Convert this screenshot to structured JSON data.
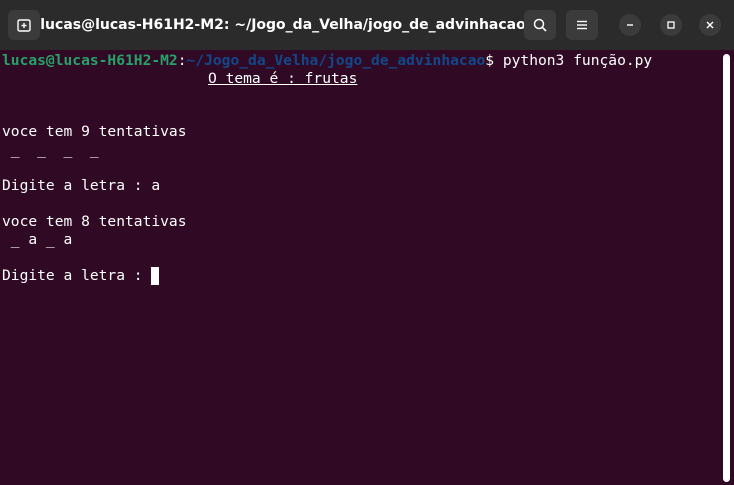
{
  "window": {
    "title": "lucas@lucas-H61H2-M2: ~/Jogo_da_Velha/jogo_de_advinhacao"
  },
  "titlebar": {
    "icons": [
      "new-tab-icon",
      "search-icon",
      "hamburger-menu-icon",
      "minimize-icon",
      "maximize-icon",
      "close-icon"
    ]
  },
  "terminal": {
    "prompt_user": "lucas@lucas-H61H2-M2",
    "prompt_sep": ":",
    "prompt_path": "~/Jogo_da_Velha/jogo_de_advinhacao",
    "prompt_symbol": "$ ",
    "command": "python3 função.py",
    "theme_line": "O tema é : frutas",
    "attempts_1": "voce tem 9 tentativas",
    "board_1": " _  _  _  _",
    "prompt_letter_1": "Digite a letra : a",
    "attempts_2": "voce tem 8 tentativas",
    "board_2": " _ a _ a",
    "prompt_letter_2": "Digite a letra : "
  },
  "colors": {
    "background": "#300a24",
    "prompt_user": "#26a269",
    "prompt_path": "#12488b",
    "titlebar": "#2b2b2b"
  }
}
